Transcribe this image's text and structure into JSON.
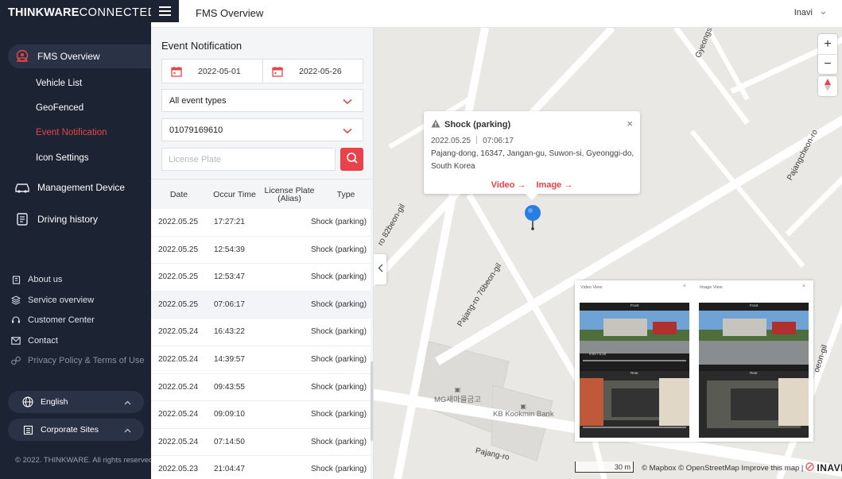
{
  "brand": {
    "bold": "THINKWARE",
    "thin": "CONNECTED"
  },
  "header": {
    "title": "FMS Overview",
    "user": "Inavi"
  },
  "sidebar": {
    "main_items": [
      {
        "label": "FMS Overview",
        "icon": "fms-icon"
      },
      {
        "label": "Management Device",
        "icon": "car-icon"
      },
      {
        "label": "Driving history",
        "icon": "history-icon"
      }
    ],
    "sub_items": [
      "Vehicle List",
      "GeoFenced",
      "Event Notification",
      "Icon Settings"
    ],
    "footer_links": [
      {
        "label": "About us",
        "icon": "building-icon"
      },
      {
        "label": "Service overview",
        "icon": "layers-icon"
      },
      {
        "label": "Customer Center",
        "icon": "headset-icon"
      },
      {
        "label": "Contact",
        "icon": "mail-icon"
      },
      {
        "label": "Privacy Policy & Terms of Use",
        "icon": "link-icon"
      }
    ],
    "language": "English",
    "corporate": "Corporate Sites",
    "copyright": "© 2022. THINKWARE. All rights reserved."
  },
  "panel": {
    "title": "Event Notification",
    "date_from": "2022-05-01",
    "date_to": "2022-05-26",
    "event_type": "All event types",
    "device": "01079169610",
    "plate_placeholder": "License Plate",
    "columns": [
      "Date",
      "Occur Time",
      "License Plate\n(Alias)",
      "Type"
    ],
    "rows": [
      {
        "date": "2022.05.25",
        "time": "17:27:21",
        "plate": "",
        "type": "Shock (parking)"
      },
      {
        "date": "2022.05.25",
        "time": "12:54:39",
        "plate": "",
        "type": "Shock (parking)"
      },
      {
        "date": "2022.05.25",
        "time": "12:53:47",
        "plate": "",
        "type": "Shock (parking)"
      },
      {
        "date": "2022.05.25",
        "time": "07:06:17",
        "plate": "",
        "type": "Shock (parking)",
        "selected": true
      },
      {
        "date": "2022.05.24",
        "time": "16:43:22",
        "plate": "",
        "type": "Shock (parking)"
      },
      {
        "date": "2022.05.24",
        "time": "14:39:57",
        "plate": "",
        "type": "Shock (parking)"
      },
      {
        "date": "2022.05.24",
        "time": "09:43:55",
        "plate": "",
        "type": "Shock (parking)"
      },
      {
        "date": "2022.05.24",
        "time": "09:09:10",
        "plate": "",
        "type": "Shock (parking)"
      },
      {
        "date": "2022.05.24",
        "time": "07:14:50",
        "plate": "",
        "type": "Shock (parking)"
      },
      {
        "date": "2022.05.23",
        "time": "21:04:47",
        "plate": "",
        "type": "Shock (parking)"
      }
    ]
  },
  "map": {
    "streets": [
      "Gyeongsu",
      "Pajangcheon-ro",
      "ro 82beon-gil",
      "Pajang-ro 76beon-gil",
      "Pajang-ro",
      "oeon-gil"
    ],
    "pois": [
      "MG새마을금고",
      "KB Kookmin Bank"
    ],
    "popup": {
      "title": "Shock (parking)",
      "date": "2022.05.25",
      "time": "07:06:17",
      "address": "Pajang-dong, 16347, Jangan-gu, Suwon-si, Gyeonggi-do, South Korea",
      "video_link": "Video →",
      "image_link": "Image →",
      "close": "×"
    },
    "preview": {
      "video_title": "Video View",
      "image_title": "Image View",
      "front_label": "Front",
      "rear_label": "Rear",
      "video_time": "0:00 / 0:20"
    },
    "zoom_in": "+",
    "zoom_out": "−",
    "scale": "30 m",
    "attribution": "© Mapbox © OpenStreetMap Improve this map |",
    "logo": "INAVI"
  }
}
